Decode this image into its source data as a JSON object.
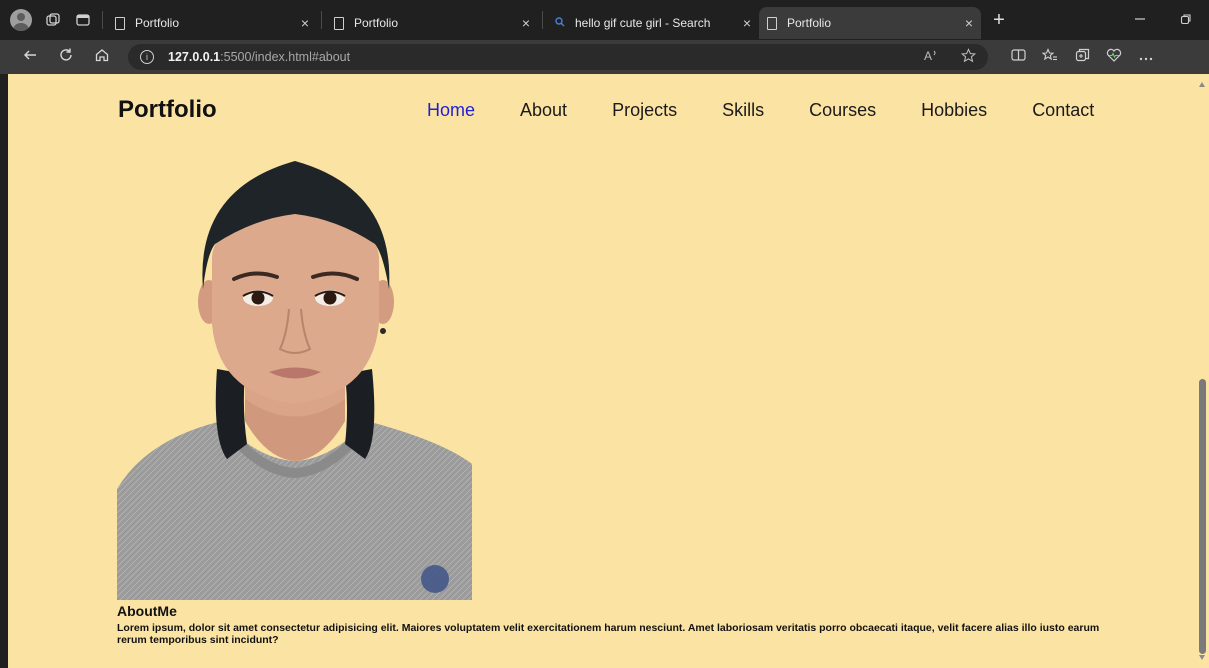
{
  "browser": {
    "tabs": [
      {
        "label": "Portfolio",
        "icon": "page-icon",
        "active": false
      },
      {
        "label": "Portfolio",
        "icon": "page-icon",
        "active": false
      },
      {
        "label": "hello gif cute girl - Search",
        "icon": "search-icon",
        "active": false
      },
      {
        "label": "Portfolio",
        "icon": "page-icon",
        "active": true
      }
    ],
    "close_glyph": "×",
    "newtab_glyph": "+",
    "url_host": "127.0.0.1",
    "url_rest": ":5500/index.html#about"
  },
  "site": {
    "logo": "Portfolio",
    "nav": [
      {
        "label": "Home",
        "active": true
      },
      {
        "label": "About",
        "active": false
      },
      {
        "label": "Projects",
        "active": false
      },
      {
        "label": "Skills",
        "active": false
      },
      {
        "label": "Courses",
        "active": false
      },
      {
        "label": "Hobbies",
        "active": false
      },
      {
        "label": "Contact",
        "active": false
      }
    ],
    "about": {
      "title": "AboutMe",
      "text": "Lorem ipsum, dolor sit amet consectetur adipisicing elit. Maiores voluptatem velit exercitationem harum nesciunt. Amet laboriosam veritatis porro obcaecati itaque, velit facere alias illo iusto earum rerum temporibus sint incidunt?"
    }
  },
  "colors": {
    "page_background": "#fbe4a3",
    "nav_active": "#1f1fd6",
    "text": "#111111"
  }
}
